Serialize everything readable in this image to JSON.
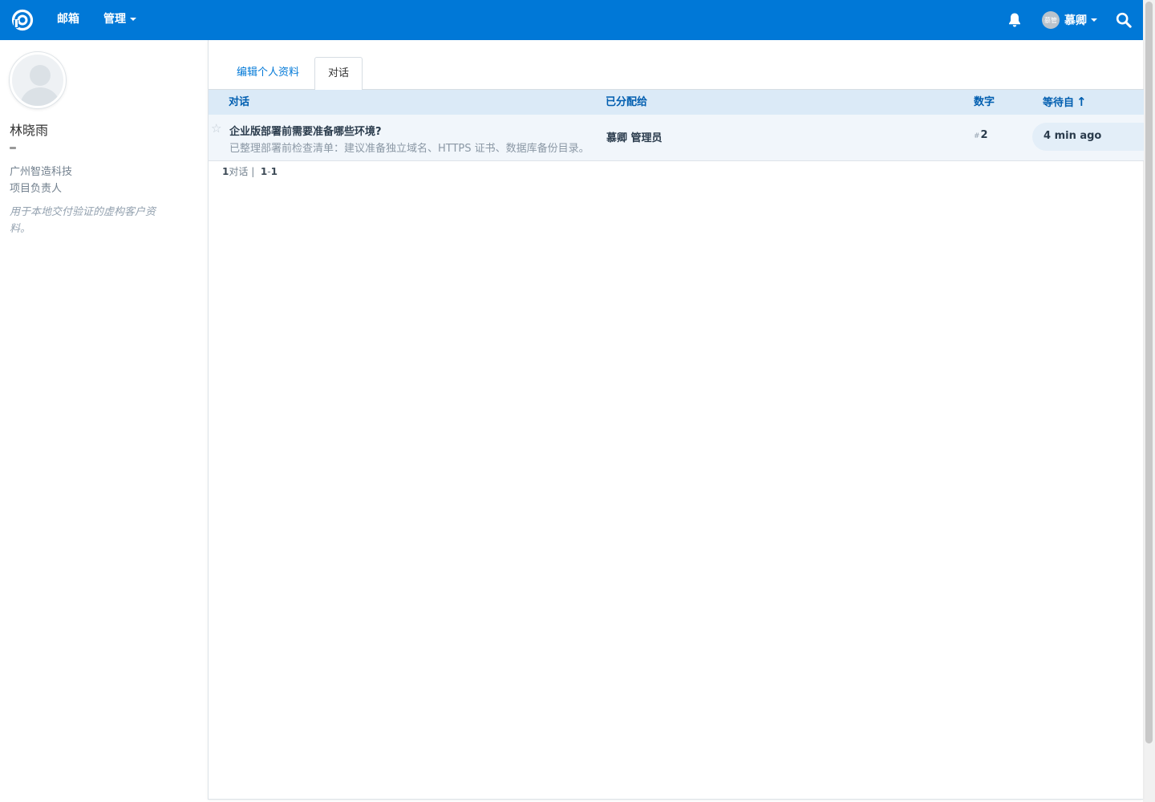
{
  "topbar": {
    "nav_mailbox": "邮箱",
    "nav_manage": "管理",
    "user_initials": "慕管",
    "user_name": "慕卿",
    "brand_color": "#0078d7"
  },
  "profile": {
    "name": "林晓雨",
    "company": "广州智造科技",
    "job_title": "项目负责人",
    "note": "用于本地交付验证的虚构客户资料。"
  },
  "tabs": [
    {
      "label": "编辑个人资料"
    },
    {
      "label": "对话"
    }
  ],
  "table": {
    "headers": {
      "conversation": "对话",
      "assigned": "已分配给",
      "number": "数字",
      "waiting_since": "等待自",
      "sort_arrow": "↑"
    },
    "rows": [
      {
        "subject": "企业版部署前需要准备哪些环境?",
        "preview": "已整理部署前检查清单：建议准备独立域名、HTTPS 证书、数据库备份目录。",
        "assignee": "慕卿 管理员",
        "hash": "#",
        "number": "2",
        "waiting": "4 min ago"
      }
    ]
  },
  "pager": {
    "count": "1",
    "label": "对话",
    "separator": "|",
    "range_start": "1",
    "range_dash": "-",
    "range_end": "1"
  }
}
